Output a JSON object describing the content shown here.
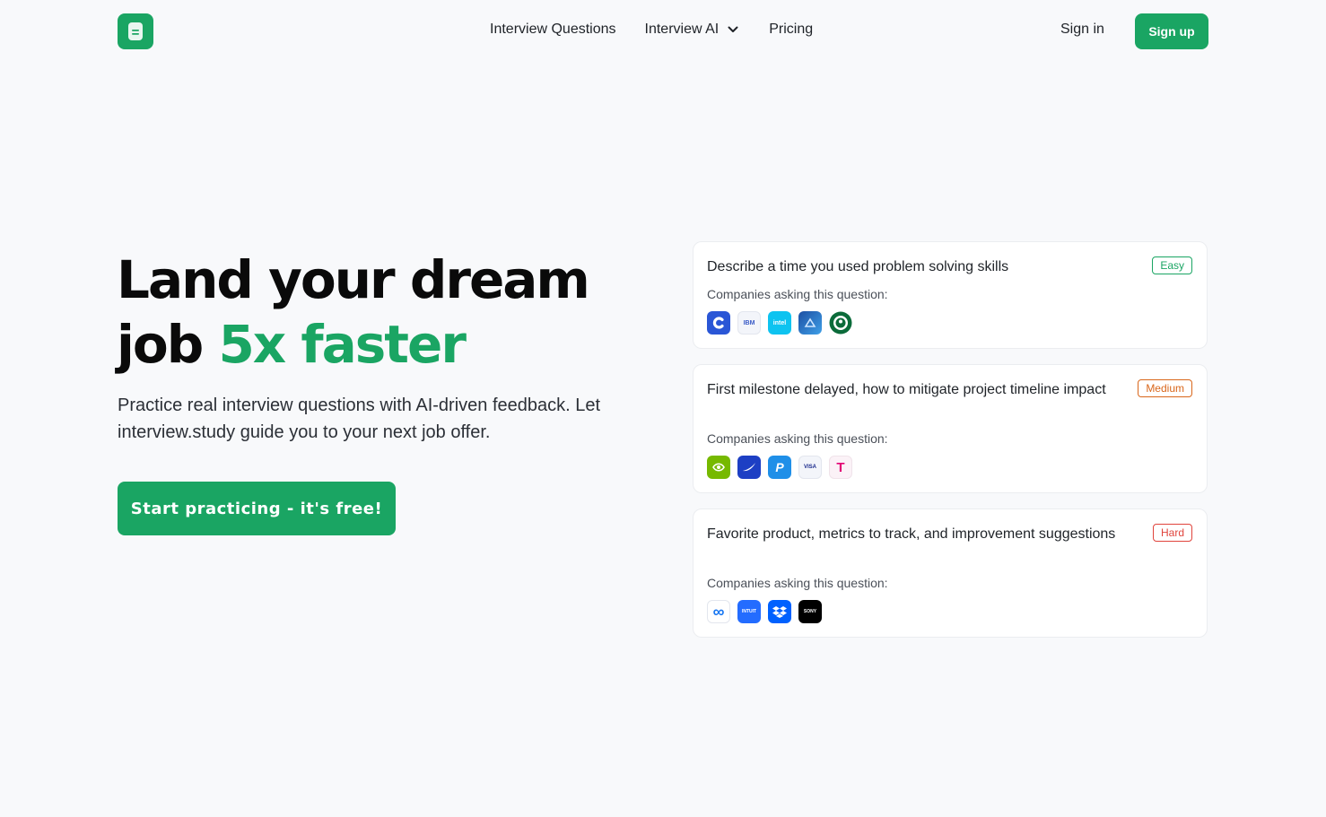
{
  "nav": {
    "logo_icon": "document-icon",
    "links": [
      {
        "label": "Interview Questions"
      },
      {
        "label": "Interview AI",
        "dropdown": true
      },
      {
        "label": "Pricing"
      }
    ],
    "signin_label": "Sign in",
    "signup_label": "Sign up"
  },
  "hero": {
    "title_line1": "Land your dream",
    "title_line2_plain": "job ",
    "title_line2_accent": "5x faster",
    "subtitle": "Practice real interview questions with AI-driven feedback. Let interview.study guide you to your next job offer.",
    "cta_label": "Start practicing - it's free!"
  },
  "colors": {
    "brand_green": "#1aa563",
    "easy": "#1aa563",
    "medium": "#d9661a",
    "hard": "#e0443c",
    "background": "#f8f9fb"
  },
  "questions": [
    {
      "question": "Describe a time you used problem solving skills",
      "difficulty": "Easy",
      "companies_label": "Companies asking this question:",
      "companies": [
        {
          "name": "coursera-logo-icon",
          "text": ""
        },
        {
          "name": "ibm-logo-icon",
          "text": "IBM"
        },
        {
          "name": "intel-logo-icon",
          "text": "intel"
        },
        {
          "name": "app-logo-icon",
          "text": ""
        },
        {
          "name": "starbucks-logo-icon",
          "text": ""
        }
      ]
    },
    {
      "question": "First milestone delayed, how to mitigate project timeline impact",
      "difficulty": "Medium",
      "companies_label": "Companies asking this question:",
      "companies": [
        {
          "name": "nvidia-logo-icon",
          "text": ""
        },
        {
          "name": "swoosh-logo-icon",
          "text": ""
        },
        {
          "name": "paypal-logo-icon",
          "text": "P"
        },
        {
          "name": "visa-logo-icon",
          "text": "VISA"
        },
        {
          "name": "t-mobile-logo-icon",
          "text": "T"
        }
      ]
    },
    {
      "question": "Favorite product, metrics to track, and improvement suggestions",
      "difficulty": "Hard",
      "companies_label": "Companies asking this question:",
      "companies": [
        {
          "name": "meta-logo-icon",
          "text": "∞"
        },
        {
          "name": "intuit-logo-icon",
          "text": "INTUIT"
        },
        {
          "name": "dropbox-logo-icon",
          "text": ""
        },
        {
          "name": "sony-logo-icon",
          "text": "SONY"
        }
      ]
    }
  ]
}
